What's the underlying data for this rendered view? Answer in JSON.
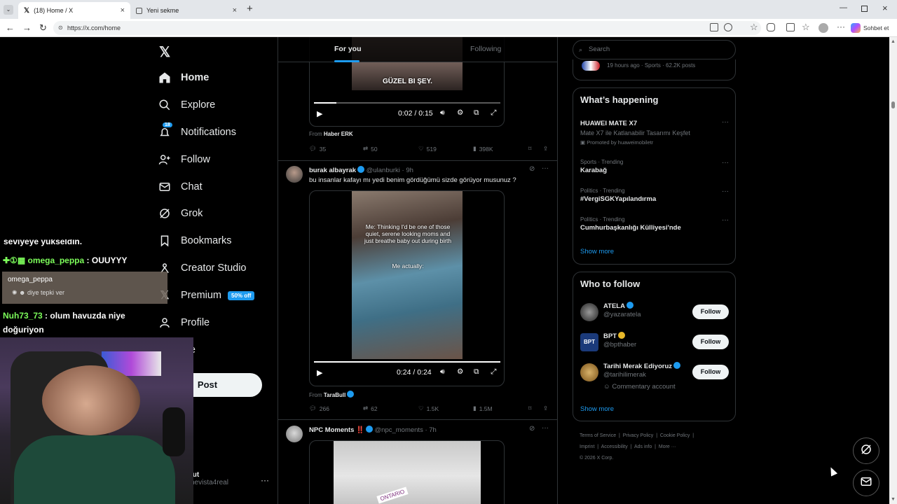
{
  "browser": {
    "tabs": [
      {
        "title": "(18) Home / X",
        "active": true
      },
      {
        "title": "Yeni sekme",
        "active": false
      }
    ],
    "url": "https://x.com/home",
    "copilot_label": "Sohbet et"
  },
  "nav": {
    "items": [
      {
        "label": "Home",
        "icon": "home-icon",
        "bold": true
      },
      {
        "label": "Explore",
        "icon": "search-icon"
      },
      {
        "label": "Notifications",
        "icon": "bell-icon",
        "badge": "18"
      },
      {
        "label": "Follow",
        "icon": "add-person-icon"
      },
      {
        "label": "Chat",
        "icon": "envelope-icon"
      },
      {
        "label": "Grok",
        "icon": "grok-icon"
      },
      {
        "label": "Bookmarks",
        "icon": "bookmark-icon"
      },
      {
        "label": "Creator Studio",
        "icon": "creator-icon"
      },
      {
        "label": "Premium",
        "icon": "x-icon",
        "badge": "50% off"
      },
      {
        "label": "Profile",
        "icon": "person-icon"
      },
      {
        "label": "ore",
        "icon": "more-icon"
      }
    ],
    "post_label": "Post",
    "account": {
      "name": "lut",
      "handle": "hevista4real"
    }
  },
  "feed": {
    "tabs": [
      "For you",
      "Following"
    ],
    "posts": [
      {
        "caption": "GÜZEL BI ŞEY.",
        "time": "0:02 / 0:15",
        "progress": 0.12,
        "from": "Haber ERK",
        "stats": {
          "replies": "35",
          "reposts": "50",
          "likes": "519",
          "views": "398K"
        }
      },
      {
        "name": "burak albayrak",
        "handle": "@ulanburki · 9h",
        "text": "bu insanlar kafayı mı yedi benim gördüğümü sizde görüyor musunuz ?",
        "overlay1": "Me:  Thinking I'd be one of those quiet, serene looking moms and just breathe baby out during birth",
        "overlay2": "Me actually:",
        "time": "0:24 / 0:24",
        "progress": 1.0,
        "from": "TaraBull",
        "stats": {
          "replies": "266",
          "reposts": "62",
          "likes": "1.5K",
          "views": "1.5M"
        }
      },
      {
        "name": "NPC Moments ‼️",
        "handle": "@npc_moments · 7h",
        "image_text": "ONTARIO"
      }
    ]
  },
  "right": {
    "search_placeholder": "Search",
    "top_trend_meta": "19 hours ago · Sports · 62.2K posts",
    "happening_title": "What’s happening",
    "trends": [
      {
        "category": "",
        "name": "HUAWEI MATE X7",
        "desc": "Mate X7 ile Katlanabilir Tasarımı Keşfet",
        "promo": "Promoted by huaweimobiletr"
      },
      {
        "category": "Sports · Trending",
        "name": "Karabağ"
      },
      {
        "category": "Politics · Trending",
        "name": "#VergiSGKYapılandırma"
      },
      {
        "category": "Politics · Trending",
        "name": "Cumhurbaşkanlığı Külliyesi'nde"
      }
    ],
    "show_more": "Show more",
    "wtf_title": "Who to follow",
    "follow": [
      {
        "name": "ATELA",
        "handle": "@yazaratela",
        "badge": "blue"
      },
      {
        "name": "BPT",
        "handle": "@bpthaber",
        "badge": "gold"
      },
      {
        "name": "Tarihi Merak Ediyoruz",
        "handle": "@tarihilimerak",
        "badge": "blue",
        "extra": "Commentary account"
      }
    ],
    "follow_label": "Follow",
    "footer": [
      "Terms of Service",
      "Privacy Policy",
      "Cookie Policy",
      "Imprint",
      "Accessibility",
      "Ads info",
      "More ···",
      "© 2026 X Corp."
    ]
  },
  "stream_chat": {
    "partial_line": "seviyeye yükseldin.",
    "msg1_user": "omega_peppa",
    "msg1_text": ": OUUYYY",
    "popup_user": "omega_peppa",
    "popup_text": "diye tepki ver",
    "msg2_user": "Nuh73_73",
    "msg2_text": ": olum havuzda niye doğuriyon"
  },
  "colors": {
    "accent": "#1d9bf0",
    "bg": "#000000",
    "border": "#2f3336",
    "muted": "#71767b",
    "chat_green": "#7CFC5A"
  }
}
